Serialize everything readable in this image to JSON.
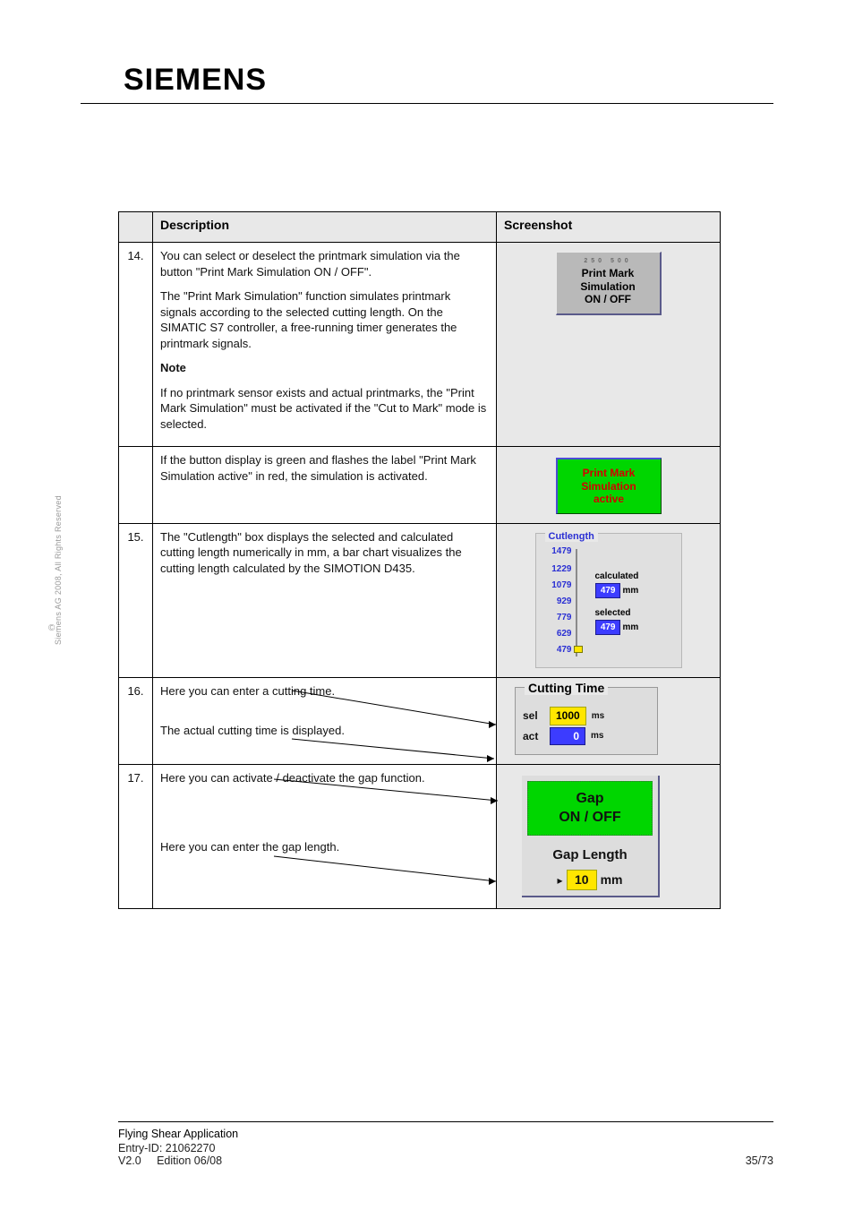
{
  "brand": "SIEMENS",
  "sidebar": {
    "copyright": "©",
    "text": "Siemens AG 2008, All Rights Reserved"
  },
  "table": {
    "headers": {
      "no": "",
      "description": "Description",
      "screenshot": "Screenshot"
    },
    "rows": [
      {
        "no": "14.",
        "desc": {
          "p1": "You can select or deselect the printmark simulation via the button \"Print Mark Simulation ON / OFF\".",
          "p2": "The \"Print Mark Simulation\" function simulates printmark signals according to the selected cutting length. On the SIMATIC S7 controller, a free-running timer generates the printmark signals.",
          "p3_bold": "Note",
          "p3": "If no printmark sensor exists and actual printmarks, the \"Print Mark Simulation\" must be activated if the \"Cut to Mark\" mode is selected."
        },
        "ui": {
          "tinyticks": "250   500",
          "line1": "Print Mark",
          "line2": "Simulation",
          "line3": "ON / OFF"
        }
      },
      {
        "no": "",
        "desc": {
          "p1": "If the button display is green and flashes the label \"Print Mark Simulation active\" in red, the simulation is activated."
        },
        "ui": {
          "line1": "Print Mark",
          "line2": "Simulation",
          "line3": "active"
        }
      },
      {
        "no": "15.",
        "desc": {
          "p1": "The \"Cutlength\" box displays the selected and calculated cutting length numerically in mm, a bar chart visualizes the cutting length calculated by the SIMOTION D435."
        },
        "ui": {
          "title": "Cutlength",
          "ticks": [
            "1479",
            "1229",
            "1079",
            "929",
            "779",
            "629",
            "479"
          ],
          "calcLabel": "calculated",
          "calcValue": "479",
          "selLabel": "selected",
          "selValue": "479",
          "unit": "mm"
        }
      },
      {
        "no": "16.",
        "desc": {
          "p1": "Here you can enter a cutting time.",
          "p2": "The actual cutting time is displayed."
        },
        "ui": {
          "title": "Cutting Time",
          "selLabel": "sel",
          "selValue": "1000",
          "actLabel": "act",
          "actValue": "0",
          "unit": "ms"
        }
      },
      {
        "no": "17.",
        "desc": {
          "p1": "Here you can activate / deactivate the gap function.",
          "p2": "Here you can enter the gap length."
        },
        "ui": {
          "btn_line1": "Gap",
          "btn_line2": "ON / OFF",
          "lenLabel": "Gap Length",
          "lenValue": "10",
          "unit": "mm"
        }
      }
    ]
  },
  "footer": {
    "title": "Flying Shear Application",
    "entry": "Entry-ID: 21062270",
    "version": "V2.0",
    "date": "Edition 06/08",
    "page": "35/73"
  }
}
